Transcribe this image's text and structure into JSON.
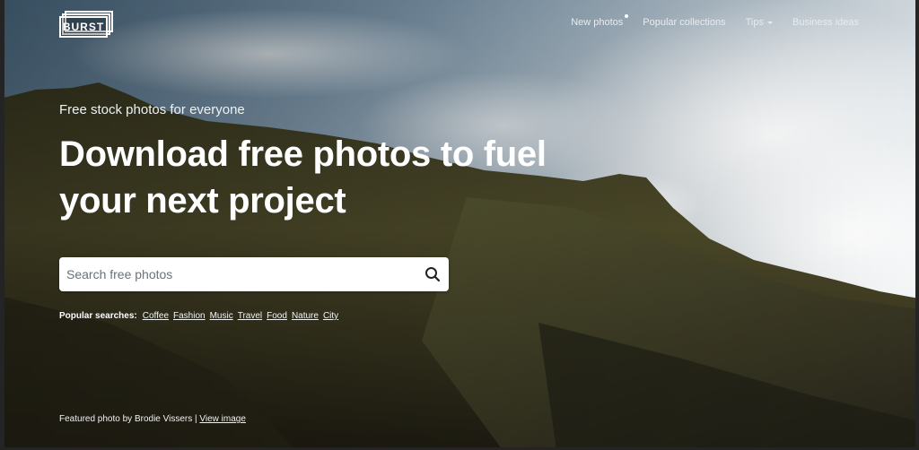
{
  "brand": {
    "logo_text": "BURST"
  },
  "nav": {
    "items": [
      {
        "label": "New photos",
        "has_dot": true
      },
      {
        "label": "Popular collections"
      },
      {
        "label": "Tips",
        "dropdown": true
      },
      {
        "label": "Business ideas"
      }
    ]
  },
  "hero": {
    "tagline": "Free stock photos for everyone",
    "headline_line1": "Download free photos to fuel",
    "headline_line2": "your next project"
  },
  "search": {
    "placeholder": "Search free photos",
    "icon": "search-icon"
  },
  "popular": {
    "label": "Popular searches:",
    "items": [
      "Coffee",
      "Fashion",
      "Music",
      "Travel",
      "Food",
      "Nature",
      "City"
    ]
  },
  "credit": {
    "text": "Featured photo by Brodie Vissers",
    "separator": "|",
    "link": "View image"
  },
  "colors": {
    "text": "#ffffff",
    "search_bg": "#ffffff",
    "search_icon": "#222222"
  }
}
